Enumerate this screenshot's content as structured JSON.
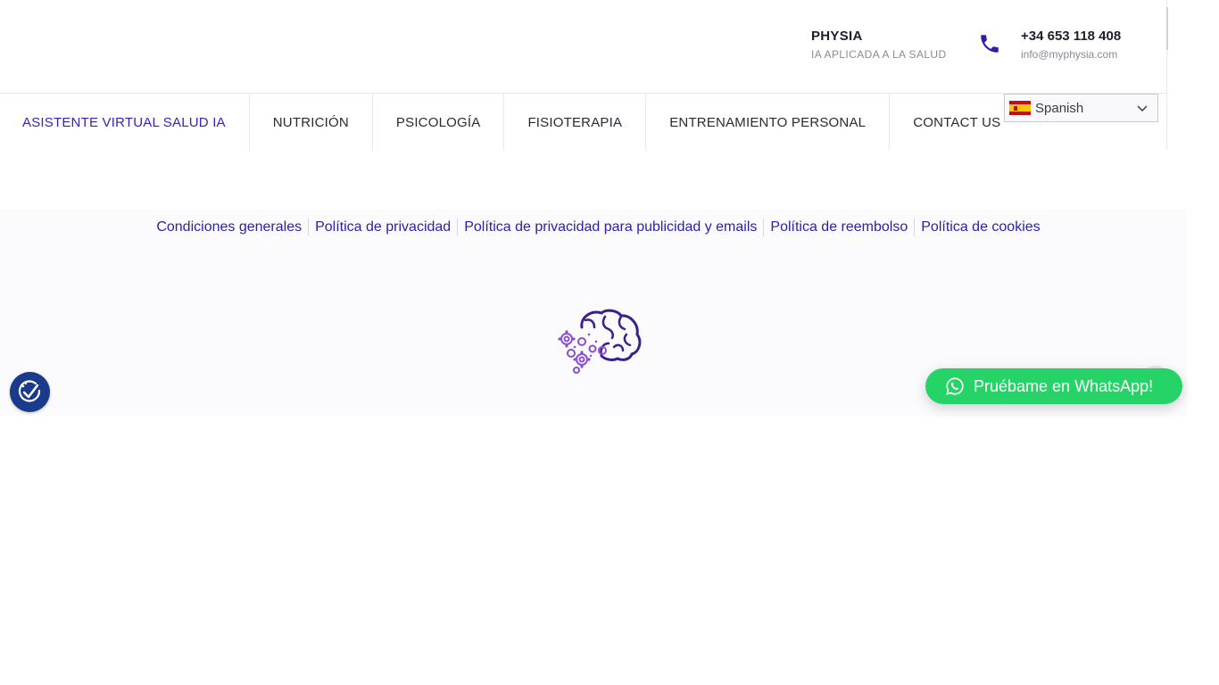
{
  "header": {
    "brand_name": "PHYSIA",
    "brand_tagline": "IA APLICADA A LA SALUD",
    "phone": "+34 653 118 408",
    "email": "info@myphysia.com"
  },
  "nav": {
    "items": [
      {
        "label": "ASISTENTE VIRTUAL SALUD IA",
        "active": true
      },
      {
        "label": "NUTRICIÓN"
      },
      {
        "label": "PSICOLOGÍA"
      },
      {
        "label": "FISIOTERAPIA"
      },
      {
        "label": "ENTRENAMIENTO PERSONAL"
      },
      {
        "label": "CONTACT US"
      }
    ]
  },
  "language": {
    "selected": "Spanish",
    "flag": "spain-flag-icon"
  },
  "footer": {
    "links": [
      "Condiciones generales",
      "Política de privacidad",
      "Política de privacidad para publicidad y emails",
      "Política de reembolso",
      "Política de cookies"
    ],
    "logo": "brain-gears-logo"
  },
  "whatsapp": {
    "label": "Pruébame en WhatsApp!",
    "icon": "whatsapp-icon"
  },
  "accessibility": {
    "icon": "accessibility-icon"
  },
  "colors": {
    "accent": "#3a22b8",
    "link": "#2c1fa8",
    "whatsapp": "#25d366",
    "accessibility": "#1a3a8c",
    "brain_logo": "#3b1f8f",
    "brain_gears": "#8a4fd0"
  }
}
